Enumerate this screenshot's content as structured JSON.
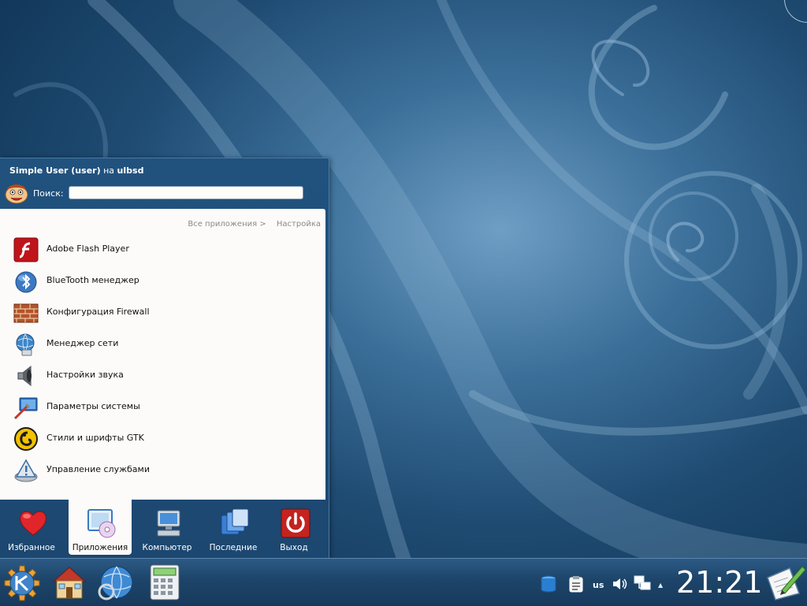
{
  "menu": {
    "user_name": "Simple User (user)",
    "user_on": "на",
    "host": "ulbsd",
    "search_label": "Поиск:",
    "search_value": "",
    "breadcrumb_all_apps": "Все приложения >",
    "breadcrumb_current": "Настройка",
    "items": [
      {
        "label": "Adobe Flash Player",
        "icon": "flash-icon"
      },
      {
        "label": "BlueTooth менеджер",
        "icon": "bluetooth-icon"
      },
      {
        "label": "Конфигурация Firewall",
        "icon": "firewall-icon"
      },
      {
        "label": "Менеджер сети",
        "icon": "network-icon"
      },
      {
        "label": "Настройки звука",
        "icon": "speaker-icon"
      },
      {
        "label": "Параметры системы",
        "icon": "system-settings-icon"
      },
      {
        "label": "Стили и шрифты GTK",
        "icon": "gtk-icon"
      },
      {
        "label": "Управление службами",
        "icon": "services-icon"
      }
    ],
    "tabs": [
      {
        "label": "Избранное",
        "icon": "heart-icon"
      },
      {
        "label": "Приложения",
        "icon": "applications-icon"
      },
      {
        "label": "Компьютер",
        "icon": "computer-icon"
      },
      {
        "label": "Последние",
        "icon": "recent-icon"
      },
      {
        "label": "Выход",
        "icon": "power-icon"
      }
    ],
    "active_tab": "Приложения"
  },
  "taskbar": {
    "launchers": [
      "kde-menu-icon",
      "home-icon",
      "browser-icon",
      "calculator-icon"
    ],
    "keyboard_layout": "us",
    "clock": "21:21",
    "tray": [
      "storage-icon",
      "clipboard-icon",
      "volume-icon",
      "network-tray-icon",
      "notes-icon"
    ]
  },
  "colors": {
    "wallpaper": "#1f4b72",
    "menu_panel": "#fcfbf9",
    "taskbar": "#1d4469"
  }
}
